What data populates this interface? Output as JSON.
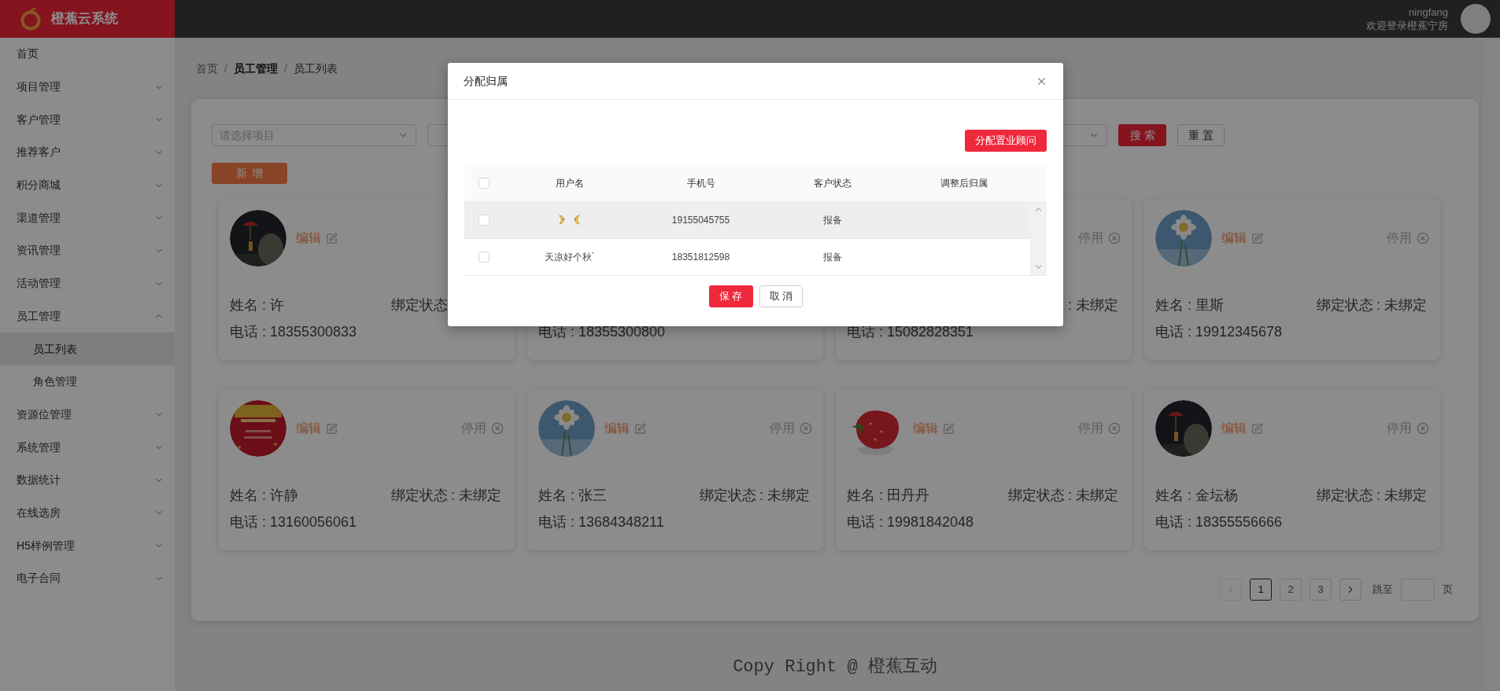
{
  "app": {
    "title": "橙蕉云系统"
  },
  "user": {
    "name": "ningfang",
    "welcome": "欢迎登录橙蕉宁房"
  },
  "sidebar": {
    "items": [
      {
        "label": "首页",
        "kind": "link"
      },
      {
        "label": "项目管理",
        "kind": "group",
        "expanded": false
      },
      {
        "label": "客户管理",
        "kind": "group",
        "expanded": false
      },
      {
        "label": "推荐客户",
        "kind": "group",
        "expanded": false
      },
      {
        "label": "积分商城",
        "kind": "group",
        "expanded": false
      },
      {
        "label": "渠道管理",
        "kind": "group",
        "expanded": false
      },
      {
        "label": "资讯管理",
        "kind": "group",
        "expanded": false
      },
      {
        "label": "活动管理",
        "kind": "group",
        "expanded": false
      },
      {
        "label": "员工管理",
        "kind": "group",
        "expanded": true,
        "children": [
          {
            "label": "员工列表",
            "selected": true
          },
          {
            "label": "角色管理",
            "selected": false
          }
        ]
      },
      {
        "label": "资源位管理",
        "kind": "group",
        "expanded": false
      },
      {
        "label": "系统管理",
        "kind": "group",
        "expanded": false
      },
      {
        "label": "数据统计",
        "kind": "group",
        "expanded": false
      },
      {
        "label": "在线选房",
        "kind": "group",
        "expanded": false
      },
      {
        "label": "H5样例管理",
        "kind": "group",
        "expanded": false
      },
      {
        "label": "电子合同",
        "kind": "group",
        "expanded": false
      }
    ]
  },
  "breadcrumb": [
    {
      "label": "首页"
    },
    {
      "separator": "/",
      "label": "员工管理"
    },
    {
      "separator": "/",
      "label": "员工列表"
    }
  ],
  "filters": {
    "selects": [
      {
        "kind": "select",
        "placeholder": "请选择项目"
      },
      {
        "kind": "select"
      },
      {
        "kind": "select"
      }
    ],
    "search_button": "搜索",
    "reset_button": "重置"
  },
  "add_button": "新增",
  "cards": [
    {
      "edit": "编辑",
      "name": "姓名 : 许",
      "binding_label": "绑定状态",
      "phone": "电话 : 18355300833"
    },
    {
      "phone": "电话 : 18355300800"
    },
    {
      "disable": "停用",
      "binding_value": ": 未绑定",
      "phone": "电话 : 15082828351"
    },
    {
      "edit": "编辑",
      "disable": "停用",
      "name": "姓名 : 里斯",
      "binding_label": "绑定状态",
      "binding_value": ": 未绑定",
      "phone": "电话 : 19912345678"
    },
    {
      "edit": "编辑",
      "disable": "停用",
      "name": "姓名 : 许静",
      "binding_label": "绑定状态",
      "binding_value": ": 未绑定",
      "phone": "电话 : 13160056061"
    },
    {
      "edit": "编辑",
      "disable": "停用",
      "name": "姓名 : 张三",
      "binding_label": "绑定状态",
      "binding_value": ": 未绑定",
      "phone": "电话 : 13684348211"
    },
    {
      "edit": "编辑",
      "disable": "停用",
      "name": "姓名 : 田丹丹",
      "binding_label": "绑定状态",
      "binding_value": ": 未绑定",
      "phone": "电话 : 19981842048"
    },
    {
      "edit": "编辑",
      "disable": "停用",
      "name": "姓名 : 金坛杨",
      "binding_label": "绑定状态",
      "binding_value": ": 未绑定",
      "phone": "电话 : 18355556666"
    }
  ],
  "pagination": {
    "prev_disabled": true,
    "pages": [
      {
        "label": "1",
        "selected": true
      },
      {
        "label": "2",
        "selected": false
      },
      {
        "label": "3",
        "selected": false
      }
    ],
    "jump_label": "跳至",
    "page_suffix": "页"
  },
  "footer": "Copy Right @ 橙蕉互动",
  "dialog": {
    "title": "分配归属",
    "assign_button": "分配置业顾问",
    "select_all_checked": false,
    "columns": [
      "用户名",
      "手机号",
      "客户状态",
      "调整后归属"
    ],
    "rows": [
      {
        "kind": "emoji",
        "phone": "19155045755",
        "status": "报备",
        "checked": false,
        "highlighted": true
      },
      {
        "kind": "text",
        "username": "天凉好个秋`",
        "phone": "18351812598",
        "status": "报备",
        "checked": false,
        "highlighted": false
      }
    ],
    "save_button": "保存",
    "cancel_button": "取消"
  }
}
